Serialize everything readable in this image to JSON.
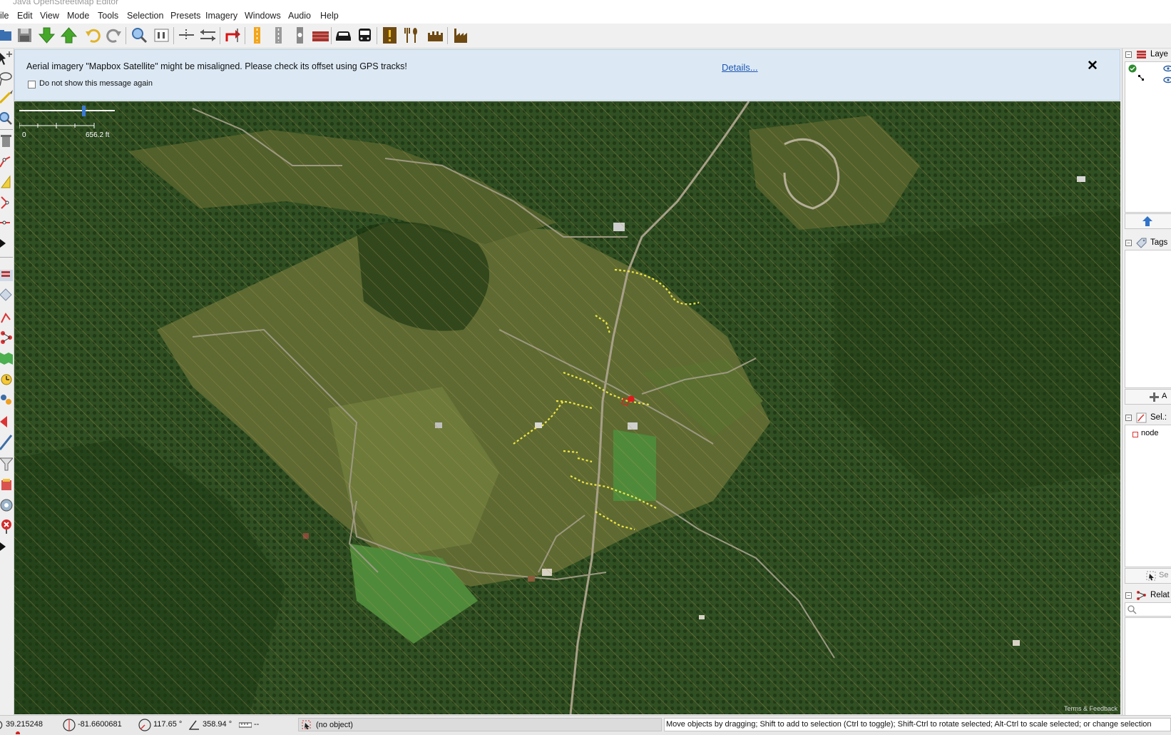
{
  "window": {
    "title": "Java OpenStreetMap Editor"
  },
  "menu": [
    "ile",
    "Edit",
    "View",
    "Mode",
    "Tools",
    "Selection",
    "Presets",
    "Imagery",
    "Windows",
    "Audio",
    "Help"
  ],
  "toolbar": {
    "buttons": [
      "open-icon",
      "save-icon",
      "download-icon",
      "upload-icon",
      "undo-icon",
      "redo-icon",
      "zoom-icon",
      "preferences-icon",
      "merge-nodes-icon",
      "split-way-icon",
      "reverse-way-icon",
      "highway-icon",
      "road-icon",
      "traffic-light-icon",
      "barrier-icon",
      "car-icon",
      "bus-icon",
      "warning-icon",
      "restaurant-icon",
      "castle-icon",
      "industrial-icon"
    ]
  },
  "notification": {
    "message": "Aerial imagery \"Mapbox Satellite\" might be misaligned. Please check its offset using GPS tracks!",
    "checkbox_label": "Do not show this message again",
    "details_link": "Details...",
    "close_glyph": "✕"
  },
  "map": {
    "scale_start": "0",
    "scale_distance": "656.2 ft",
    "attribution": "Terms & Feedback",
    "selected_node_color": "#e01a1a",
    "gps_track_color": "#f2e640"
  },
  "right_panel": {
    "layers_title": "Laye",
    "tags_title": "Tags",
    "tags_add_label": "A",
    "selection_title": "Sel.:",
    "selection_item": "node",
    "selection_search_label": "Se",
    "relations_title": "Relat"
  },
  "status": {
    "lat": "39.215248",
    "lon": "-81.6600681",
    "heading": "117.65 °",
    "angle": "358.94 °",
    "distance": "--",
    "object": "(no object)",
    "help": "Move objects by dragging; Shift to add to selection (Ctrl to toggle); Shift-Ctrl to rotate selected; Alt-Ctrl to scale selected; or change selection"
  }
}
